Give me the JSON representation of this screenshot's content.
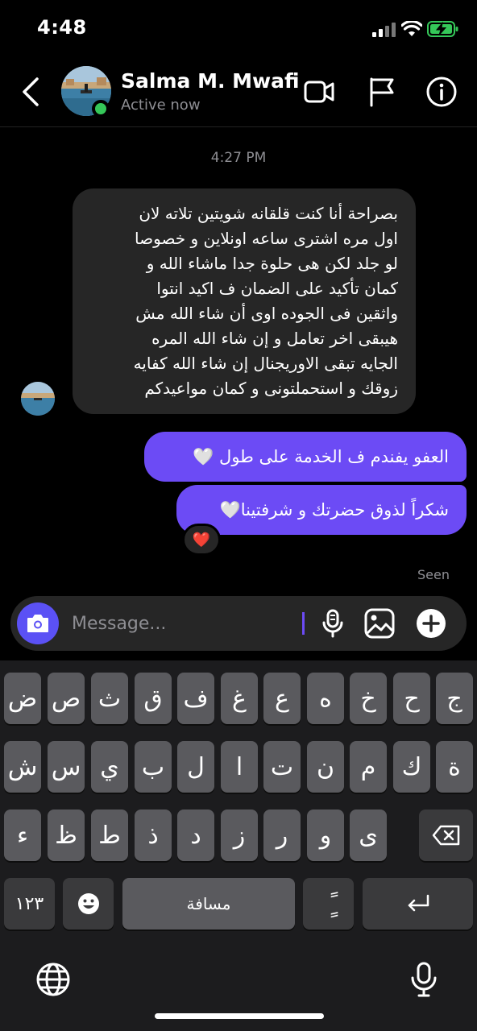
{
  "status_bar": {
    "time": "4:48"
  },
  "header": {
    "name": "Salma M. Mwafi",
    "status": "Active now"
  },
  "chat": {
    "timestamp": "4:27 PM",
    "incoming": [
      "بصراحة أنا كنت قلقانه شويتين تلاته لان",
      "اول مره اشترى ساعه اونلاين و خصوصا",
      "لو جلد لكن هى حلوة جدا ماشاء الله و",
      "كمان تأكيد على الضمان ف اكيد انتوا",
      "واثقين فى الجوده اوى  أن شاء الله مش",
      "هيبقى اخر تعامل و إن شاء الله المره",
      "الجايه تبقى الاوريجنال إن شاء الله كفايه",
      "زوقك و استحملتونى و كمان مواعيدكم"
    ],
    "outgoing": [
      "العفو يفندم ف الخدمة على طول 🤍",
      "شكراً لذوق حضرتك و شرفتينا🤍"
    ],
    "reaction": "❤️",
    "seen_label": "Seen"
  },
  "composer": {
    "placeholder": "Message..."
  },
  "keyboard": {
    "row1": [
      "ض",
      "ص",
      "ث",
      "ق",
      "ف",
      "غ",
      "ع",
      "ه",
      "خ",
      "ح",
      "ج"
    ],
    "row2": [
      "ش",
      "س",
      "ي",
      "ب",
      "ل",
      "ا",
      "ت",
      "ن",
      "م",
      "ك",
      "ة"
    ],
    "row3": [
      "ء",
      "ظ",
      "ط",
      "ذ",
      "د",
      "ز",
      "ر",
      "و",
      "ى"
    ],
    "numbers_key": "١٢٣",
    "space_key": "مسافة",
    "diacritic_key": "ًٍ"
  },
  "icons": [
    "back-icon",
    "video-call-icon",
    "flag-icon",
    "info-icon",
    "camera-icon",
    "microphone-icon",
    "gallery-icon",
    "plus-icon",
    "backspace-icon",
    "emoji-icon",
    "return-icon",
    "globe-icon",
    "dictation-icon"
  ],
  "colors": {
    "accent": "#6c4bf5",
    "camera_button": "#5b51f5",
    "incoming_bubble": "#262626",
    "online": "#35c759",
    "key": "#5a5a5e"
  }
}
